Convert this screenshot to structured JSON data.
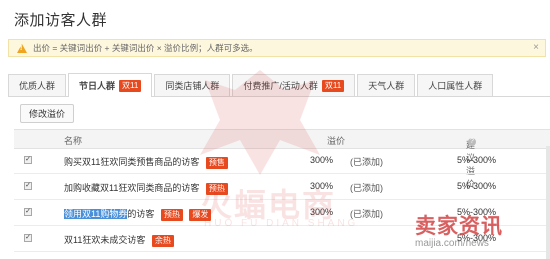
{
  "page_title": "添加访客人群",
  "notice": {
    "text": "出价 = 关键词出价 + 关键词出价 × 溢价比例；人群可多选。",
    "close_glyph": "×"
  },
  "tabs": [
    {
      "label": "优质人群",
      "badge": ""
    },
    {
      "label": "节日人群",
      "badge": "双11"
    },
    {
      "label": "同类店铺人群",
      "badge": ""
    },
    {
      "label": "付费推广/活动人群",
      "badge": "双11"
    },
    {
      "label": "天气人群",
      "badge": ""
    },
    {
      "label": "人口属性人群",
      "badge": ""
    }
  ],
  "active_tab_index": 1,
  "modify_button_label": "修改溢价",
  "table": {
    "headers": {
      "name": "名称",
      "premium": "溢价",
      "suggested": "建议溢价"
    },
    "rows": [
      {
        "checked": true,
        "name": "购买双11狂欢同类预售商品的访客",
        "name_highlight": "",
        "tags": [
          "预售"
        ],
        "premium": "300%",
        "status": "(已添加)",
        "suggested": "5%-300%"
      },
      {
        "checked": true,
        "name": "加购收藏双11狂欢同类商品的访客",
        "name_highlight": "",
        "tags": [
          "预热"
        ],
        "premium": "300%",
        "status": "(已添加)",
        "suggested": "5%-300%"
      },
      {
        "checked": true,
        "name": "的访客",
        "name_highlight": "领用双11购物券",
        "tags": [
          "预热",
          "爆发"
        ],
        "premium": "300%",
        "status": "(已添加)",
        "suggested": "5%-300%"
      },
      {
        "checked": true,
        "name": "双11狂欢未成交访客",
        "name_highlight": "",
        "tags": [
          "余热"
        ],
        "premium": "",
        "status": "",
        "suggested": "5%-300%"
      }
    ]
  },
  "watermarks": {
    "center_text": "火蝠电商",
    "center_sub": "HUO FU DIAN SHANG",
    "corner_text": "卖家资讯",
    "corner_url": "maijia.com/news"
  },
  "colors": {
    "tag_red": "#e84a1f",
    "highlight_blue": "#4a90d9",
    "notice_bg": "#fdf7de"
  }
}
